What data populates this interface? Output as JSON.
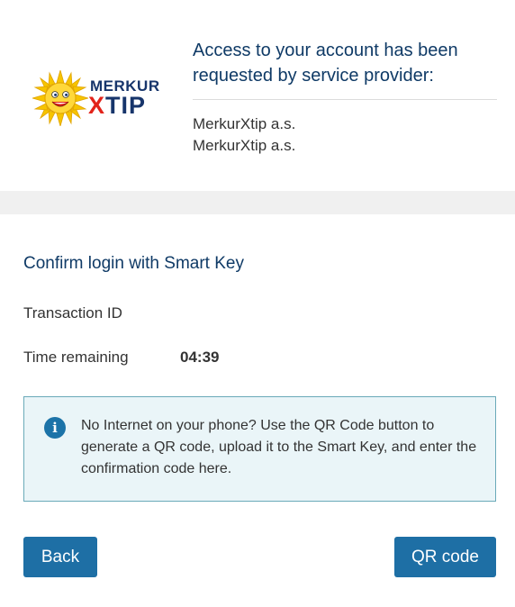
{
  "logo": {
    "line1": "MERKUR",
    "line2_x": "X",
    "line2_rest": "TIP"
  },
  "request": {
    "heading": "Access to your account has been requested by service provider:",
    "providers": [
      "MerkurXtip a.s.",
      "MerkurXtip a.s."
    ]
  },
  "confirm": {
    "title": "Confirm login with Smart Key",
    "transaction_label": "Transaction ID",
    "time_label": "Time remaining",
    "time_value": "04:39"
  },
  "info": {
    "icon": "info-icon",
    "text": "No Internet on your phone? Use the QR Code button to generate a QR code, upload it to the Smart Key, and enter the confirmation code here."
  },
  "buttons": {
    "back": "Back",
    "qr": "QR code"
  },
  "colors": {
    "heading": "#0f3a66",
    "button": "#1e6fa5",
    "info_bg": "#eaf5f8",
    "info_border": "#6aaab9",
    "logo_navy": "#17356b",
    "logo_red": "#e2231a",
    "sun_yellow": "#f6c400"
  }
}
